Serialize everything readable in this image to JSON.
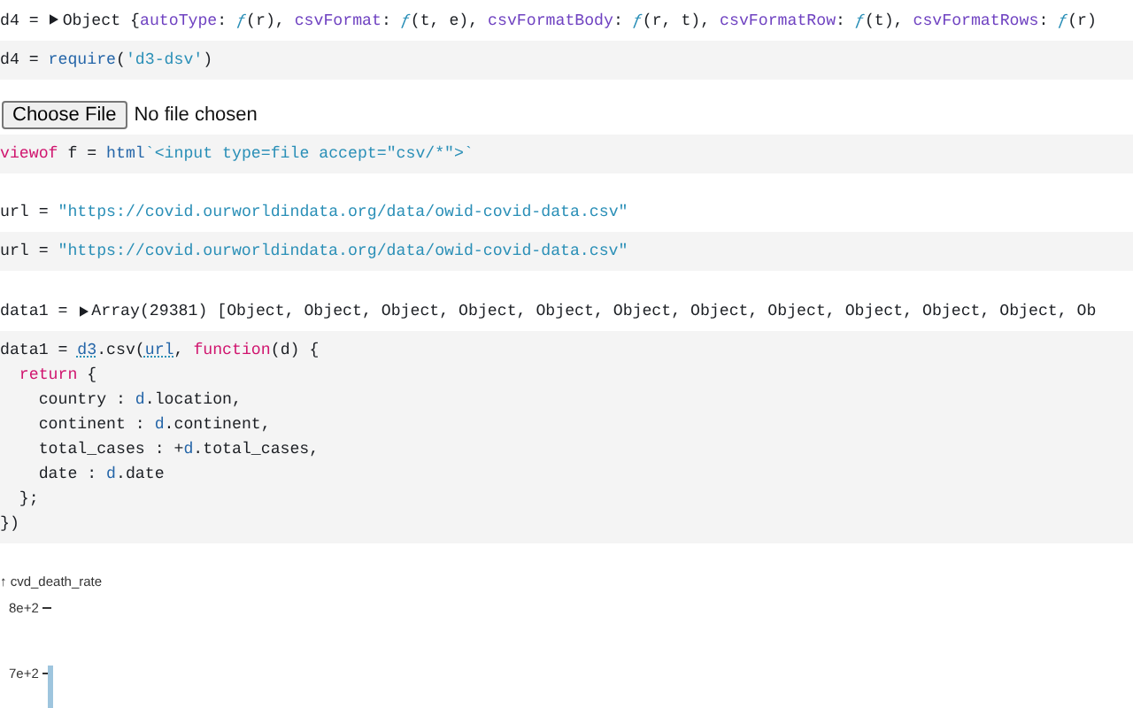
{
  "cells": [
    {
      "kind": "inspector",
      "prefix": "d4 =",
      "expanded": false,
      "tokens": [
        {
          "kind": "plain",
          "text": "Object {"
        },
        {
          "kind": "prop",
          "text": "autoType"
        },
        {
          "kind": "plain",
          "text": ": "
        },
        {
          "kind": "fn",
          "text": "ƒ"
        },
        {
          "kind": "plain",
          "text": "(r), "
        },
        {
          "kind": "prop",
          "text": "csvFormat"
        },
        {
          "kind": "plain",
          "text": ": "
        },
        {
          "kind": "fn",
          "text": "ƒ"
        },
        {
          "kind": "plain",
          "text": "(t, e), "
        },
        {
          "kind": "prop",
          "text": "csvFormatBody"
        },
        {
          "kind": "plain",
          "text": ": "
        },
        {
          "kind": "fn",
          "text": "ƒ"
        },
        {
          "kind": "plain",
          "text": "(r, t), "
        },
        {
          "kind": "prop",
          "text": "csvFormatRow"
        },
        {
          "kind": "plain",
          "text": ": "
        },
        {
          "kind": "fn",
          "text": "ƒ"
        },
        {
          "kind": "plain",
          "text": "(t), "
        },
        {
          "kind": "prop",
          "text": "csvFormatRows"
        },
        {
          "kind": "plain",
          "text": ": "
        },
        {
          "kind": "fn",
          "text": "ƒ"
        },
        {
          "kind": "plain",
          "text": "(r)"
        }
      ]
    },
    {
      "kind": "code",
      "lines": [
        [
          {
            "kind": "plain",
            "text": "d4 = "
          },
          {
            "kind": "name",
            "text": "require"
          },
          {
            "kind": "plain",
            "text": "("
          },
          {
            "kind": "string",
            "text": "'d3-dsv'"
          },
          {
            "kind": "plain",
            "text": ")"
          }
        ]
      ]
    },
    {
      "kind": "file_input",
      "button": "Choose File",
      "status": "No file chosen"
    },
    {
      "kind": "code",
      "lines": [
        [
          {
            "kind": "keyword",
            "text": "viewof"
          },
          {
            "kind": "plain",
            "text": " f = "
          },
          {
            "kind": "name",
            "text": "html"
          },
          {
            "kind": "string",
            "text": "`<input type=file accept=\"csv/*\">`"
          }
        ]
      ]
    },
    {
      "kind": "value",
      "prefix": "url =",
      "tokens": [
        {
          "kind": "string",
          "text": "\"https://covid.ourworldindata.org/data/owid-covid-data.csv\""
        }
      ]
    },
    {
      "kind": "code",
      "lines": [
        [
          {
            "kind": "plain",
            "text": "url = "
          },
          {
            "kind": "string",
            "text": "\"https://covid.ourworldindata.org/data/owid-covid-data.csv\""
          }
        ]
      ]
    },
    {
      "kind": "inspector",
      "prefix": "data1 =",
      "expanded": false,
      "tokens": [
        {
          "kind": "plain",
          "text": "Array(29381) [Object, Object, Object, Object, Object, Object, Object, Object, Object, Object, Object, Ob"
        }
      ]
    },
    {
      "kind": "code",
      "lines": [
        [
          {
            "kind": "plain",
            "text": "data1 = "
          },
          {
            "kind": "ref",
            "text": "d3"
          },
          {
            "kind": "plain",
            "text": ".csv("
          },
          {
            "kind": "ref",
            "text": "url"
          },
          {
            "kind": "plain",
            "text": ", "
          },
          {
            "kind": "keyword",
            "text": "function"
          },
          {
            "kind": "plain",
            "text": "(d) {"
          }
        ],
        [
          {
            "kind": "keyword",
            "text": "  return"
          },
          {
            "kind": "plain",
            "text": " {"
          }
        ],
        [
          {
            "kind": "plain",
            "text": "    country : "
          },
          {
            "kind": "name",
            "text": "d"
          },
          {
            "kind": "plain",
            "text": ".location,"
          }
        ],
        [
          {
            "kind": "plain",
            "text": "    continent : "
          },
          {
            "kind": "name",
            "text": "d"
          },
          {
            "kind": "plain",
            "text": ".continent,"
          }
        ],
        [
          {
            "kind": "plain",
            "text": "    total_cases : +"
          },
          {
            "kind": "name",
            "text": "d"
          },
          {
            "kind": "plain",
            "text": ".total_cases,"
          }
        ],
        [
          {
            "kind": "plain",
            "text": "    date : "
          },
          {
            "kind": "name",
            "text": "d"
          },
          {
            "kind": "plain",
            "text": ".date"
          }
        ],
        [
          {
            "kind": "plain",
            "text": "  };"
          }
        ],
        [
          {
            "kind": "plain",
            "text": "})"
          }
        ]
      ]
    }
  ],
  "chart": {
    "axis_label": "↑ cvd_death_rate",
    "ticks": [
      "8e+2",
      "7e+2"
    ]
  }
}
